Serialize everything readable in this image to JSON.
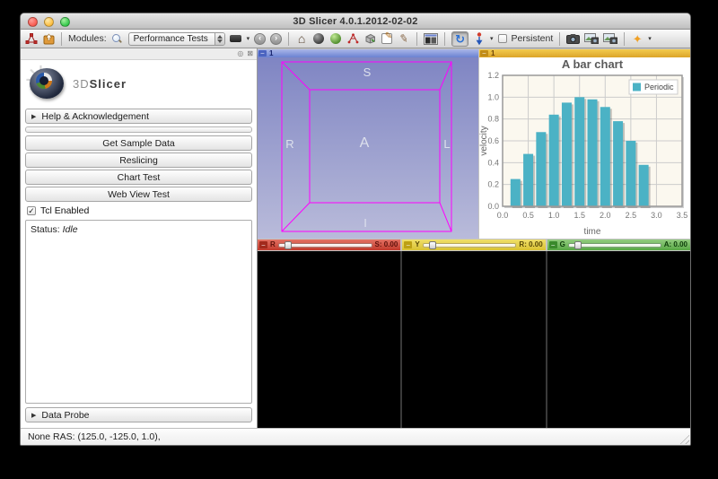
{
  "window": {
    "title": "3D Slicer 4.0.1.2012-02-02"
  },
  "toolbar": {
    "modules_label": "Modules:",
    "module_selector_value": "Performance Tests",
    "persistent_label": "Persistent"
  },
  "glyphs": {
    "panel_float": "◎",
    "panel_close": "⊠",
    "collapse_arrow": "▶",
    "home": "⌂",
    "back": "‹",
    "forward": "›",
    "rotate_mode": "↻",
    "caret_down": "▾",
    "pencil": "✎",
    "pen": "✎",
    "annotation_star": "✦",
    "check": "✓",
    "menu_dash": "–"
  },
  "left_panel": {
    "logo_text_3d": "3D",
    "logo_text_slicer": "Slicer",
    "help_section_label": "Help & Acknowledgement",
    "buttons": [
      "Get Sample Data",
      "Reslicing",
      "Chart Test",
      "Web View Test"
    ],
    "tcl_checkbox_label": "Tcl Enabled",
    "tcl_checked": true,
    "status_label": "Status:",
    "status_value": "Idle",
    "data_probe_label": "Data Probe"
  },
  "viewports": {
    "threeD": {
      "tab_label": "1",
      "orientation": {
        "superior": "S",
        "inferior": "I",
        "left": "L",
        "right": "R",
        "anterior": "A"
      },
      "wireframe_color": "#ff00ff"
    },
    "chart": {
      "tab_label": "1"
    },
    "slice_controllers": [
      {
        "name": "Red",
        "letter": "R",
        "value_label": "S: 0.00",
        "color": "#c23a2c"
      },
      {
        "name": "Yellow",
        "letter": "Y",
        "value_label": "R: 0.00",
        "color": "#d9c232"
      },
      {
        "name": "Green",
        "letter": "G",
        "value_label": "A: 0.00",
        "color": "#58a845"
      }
    ]
  },
  "status_bar": {
    "text": "None RAS: (125.0, -125.0, 1.0),"
  },
  "chart_data": {
    "type": "bar",
    "title": "A bar chart",
    "xlabel": "time",
    "ylabel": "velocity",
    "legend": [
      "Periodic"
    ],
    "legend_position": "top-right",
    "grid": true,
    "bar_color": "#4bb2c5",
    "plot_bg": "#fbf8ef",
    "x": [
      0.25,
      0.5,
      0.75,
      1.0,
      1.25,
      1.5,
      1.75,
      2.0,
      2.25,
      2.5,
      2.75
    ],
    "values": [
      0.25,
      0.48,
      0.68,
      0.84,
      0.95,
      1.0,
      0.98,
      0.91,
      0.78,
      0.6,
      0.38
    ],
    "xlim": [
      0.0,
      3.5
    ],
    "ylim": [
      0.0,
      1.2
    ],
    "xticks": [
      0.0,
      0.5,
      1.0,
      1.5,
      2.0,
      2.5,
      3.0,
      3.5
    ],
    "yticks": [
      0.0,
      0.2,
      0.4,
      0.6,
      0.8,
      1.0,
      1.2
    ]
  }
}
